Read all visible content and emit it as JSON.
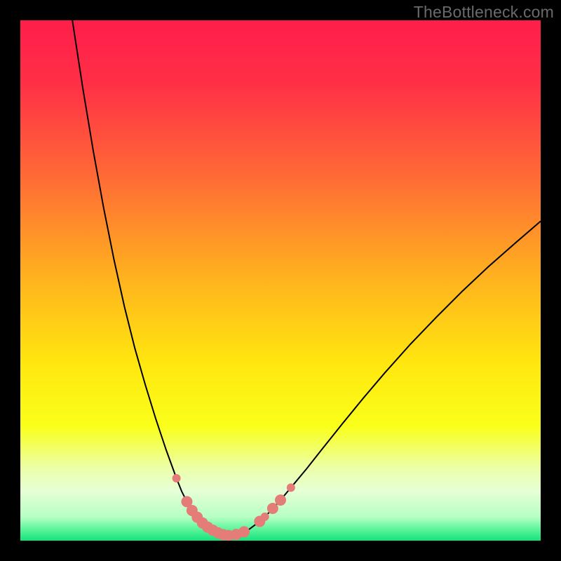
{
  "watermark": "TheBottleneck.com",
  "chart_data": {
    "type": "line",
    "title": "",
    "xlabel": "",
    "ylabel": "",
    "xlim": [
      0,
      100
    ],
    "ylim": [
      0,
      100
    ],
    "gradient_stops": [
      {
        "offset": 0.0,
        "color": "#ff1e4b"
      },
      {
        "offset": 0.12,
        "color": "#ff2f46"
      },
      {
        "offset": 0.3,
        "color": "#ff6a36"
      },
      {
        "offset": 0.5,
        "color": "#ffb41e"
      },
      {
        "offset": 0.66,
        "color": "#ffe70f"
      },
      {
        "offset": 0.78,
        "color": "#faff1a"
      },
      {
        "offset": 0.86,
        "color": "#ecffa8"
      },
      {
        "offset": 0.905,
        "color": "#e6ffd6"
      },
      {
        "offset": 0.955,
        "color": "#b6ffc3"
      },
      {
        "offset": 0.975,
        "color": "#66f7a0"
      },
      {
        "offset": 1.0,
        "color": "#14e27b"
      }
    ],
    "series": [
      {
        "name": "bottleneck-curve",
        "color": "#000000",
        "x": [
          10.0,
          12.0,
          14.0,
          16.0,
          18.0,
          20.0,
          22.0,
          24.0,
          26.0,
          28.0,
          30.0,
          31.0,
          32.0,
          33.0,
          34.0,
          35.0,
          36.0,
          37.0,
          38.0,
          39.0,
          40.0,
          41.0,
          42.0,
          44.0,
          46.0,
          48.0,
          50.0,
          52.0,
          55.0,
          58.0,
          62.0,
          66.0,
          70.0,
          75.0,
          80.0,
          85.0,
          90.0,
          95.0,
          100.0
        ],
        "y": [
          100.0,
          87.0,
          75.0,
          64.0,
          54.0,
          45.0,
          37.0,
          30.0,
          23.5,
          17.5,
          12.0,
          9.5,
          7.5,
          5.8,
          4.5,
          3.4,
          2.6,
          2.0,
          1.5,
          1.15,
          1.0,
          1.1,
          1.35,
          2.2,
          3.7,
          5.6,
          7.8,
          10.2,
          13.8,
          17.6,
          22.6,
          27.5,
          32.2,
          37.8,
          43.0,
          48.0,
          52.7,
          57.1,
          61.4
        ]
      }
    ],
    "markers": {
      "name": "highlight-points",
      "color": "#e47c78",
      "radius_small": 6,
      "radius_large": 8,
      "points": [
        {
          "x": 30.0,
          "y": 12.0,
          "r": 6
        },
        {
          "x": 32.0,
          "y": 7.5,
          "r": 8
        },
        {
          "x": 33.0,
          "y": 5.8,
          "r": 8
        },
        {
          "x": 34.0,
          "y": 4.5,
          "r": 8
        },
        {
          "x": 35.0,
          "y": 3.4,
          "r": 8
        },
        {
          "x": 36.0,
          "y": 2.6,
          "r": 8
        },
        {
          "x": 37.0,
          "y": 2.0,
          "r": 8
        },
        {
          "x": 38.0,
          "y": 1.5,
          "r": 8
        },
        {
          "x": 39.0,
          "y": 1.15,
          "r": 8
        },
        {
          "x": 40.0,
          "y": 1.0,
          "r": 8
        },
        {
          "x": 41.5,
          "y": 1.2,
          "r": 8
        },
        {
          "x": 43.0,
          "y": 1.7,
          "r": 8
        },
        {
          "x": 46.0,
          "y": 3.7,
          "r": 8
        },
        {
          "x": 47.0,
          "y": 4.6,
          "r": 6
        },
        {
          "x": 48.5,
          "y": 6.2,
          "r": 8
        },
        {
          "x": 50.0,
          "y": 7.8,
          "r": 8
        },
        {
          "x": 52.0,
          "y": 10.2,
          "r": 6
        }
      ]
    }
  }
}
